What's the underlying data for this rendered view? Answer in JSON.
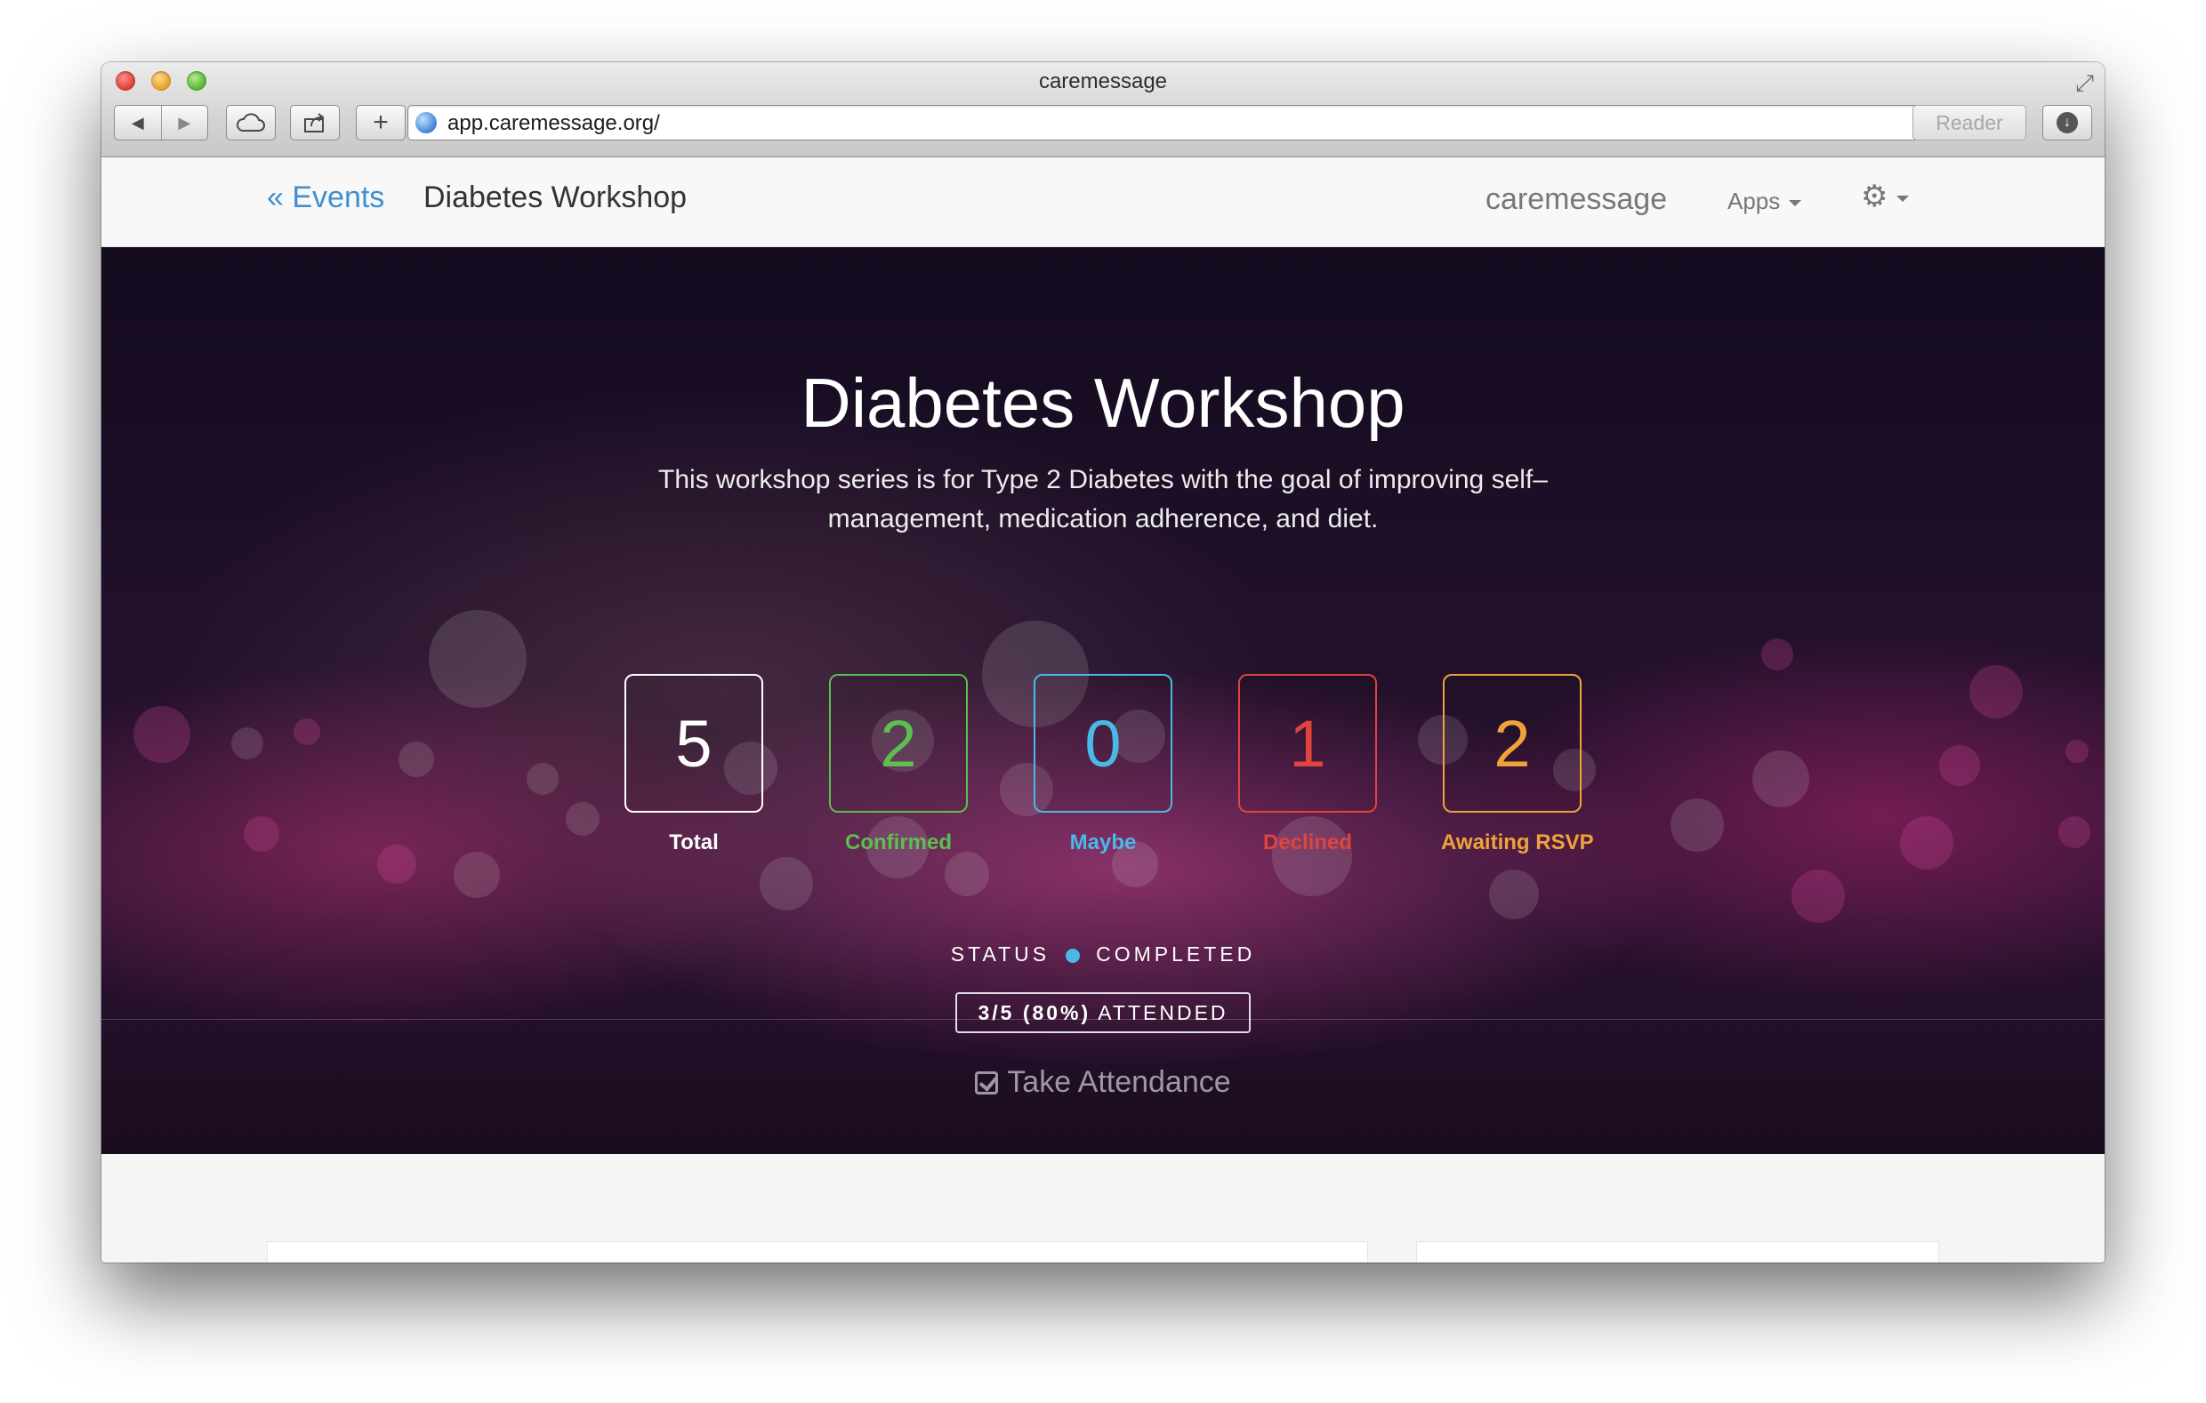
{
  "browser": {
    "window_title": "caremessage",
    "url": "app.caremessage.org/",
    "reader_label": "Reader",
    "nav_back_glyph": "◀",
    "nav_forward_glyph": "▶",
    "add_glyph": "+",
    "reload_glyph": "↻",
    "download_glyph": "↓",
    "fullscreen_glyph": "⤢"
  },
  "appnav": {
    "back_link": "« Events",
    "page_title": "Diabetes Workshop",
    "brand": "caremessage",
    "apps_label": "Apps",
    "settings_glyph": "⚙"
  },
  "hero": {
    "title": "Diabetes Workshop",
    "description": "This workshop series is for Type 2 Diabetes with the goal of improving self–management, medication adherence, and diet.",
    "stats": [
      {
        "value": "5",
        "label": "Total",
        "color": "#ffffff"
      },
      {
        "value": "2",
        "label": "Confirmed",
        "color": "#5cbf4f"
      },
      {
        "value": "0",
        "label": "Maybe",
        "color": "#4ab9e6"
      },
      {
        "value": "1",
        "label": "Declined",
        "color": "#e0443e"
      },
      {
        "value": "2",
        "label": "Awaiting RSVP",
        "color": "#f0a23a"
      }
    ],
    "status_label": "STATUS",
    "status_value": "COMPLETED",
    "status_color": "#4ab9e6",
    "attended_count": "3/5 (80%)",
    "attended_label": "ATTENDED",
    "take_attendance": "Take Attendance"
  }
}
